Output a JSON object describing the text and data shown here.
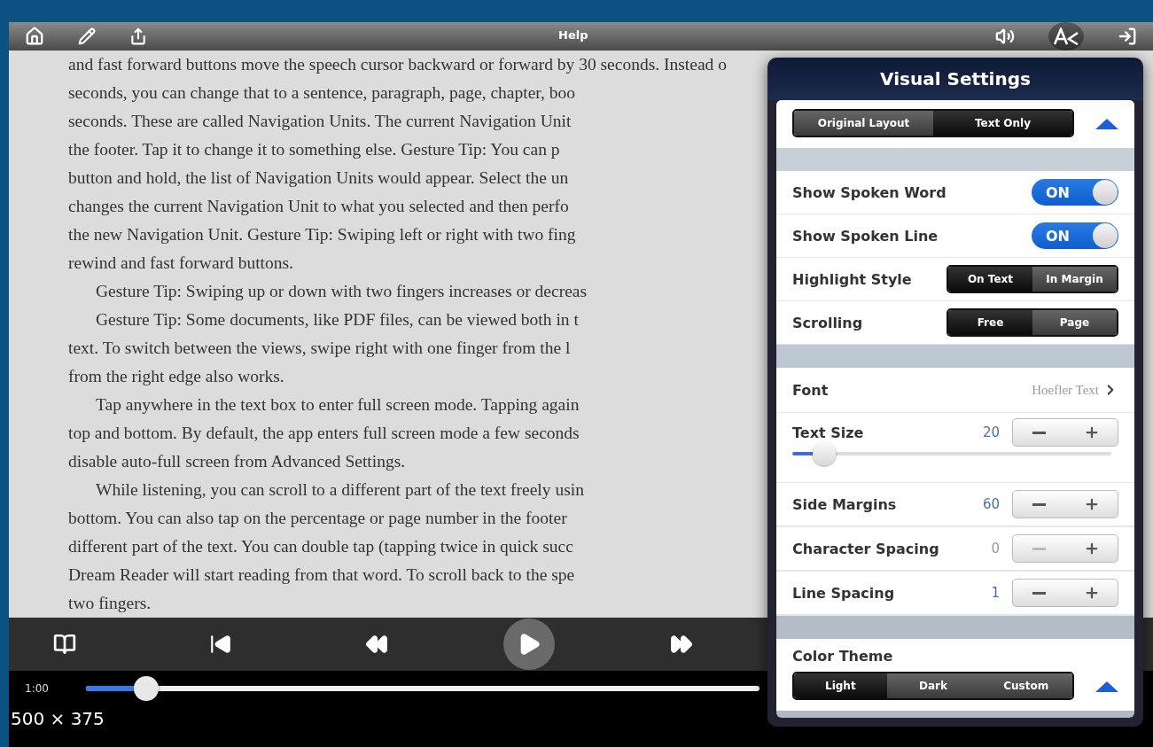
{
  "toolbar": {
    "title": "Help",
    "text_settings_selected": true
  },
  "reader": {
    "lines": [
      {
        "text": "and fast forward buttons move the speech cursor backward or forward by 30 seconds. Instead o",
        "indent": false
      },
      {
        "text": "seconds, you can change that to a sentence, paragraph, page, chapter, boo",
        "indent": false
      },
      {
        "text": "seconds. These are called Navigation Units. The current Navigation Unit",
        "indent": false
      },
      {
        "text": "the footer. Tap it to change it to something else. Gesture Tip: You can p",
        "indent": false
      },
      {
        "text": "button and hold, the list of Navigation Units would appear. Select the un",
        "indent": false
      },
      {
        "text": "changes the current Navigation Unit to what you selected and then perfo",
        "indent": false
      },
      {
        "text": "the new Navigation Unit. Gesture Tip: Swiping left or right with two fing",
        "indent": false
      },
      {
        "text": "rewind and fast forward buttons.",
        "indent": false
      },
      {
        "text": "Gesture Tip: Swiping up or down with two fingers increases or decreas",
        "indent": true
      },
      {
        "text": "Gesture Tip: Some documents, like PDF files, can be viewed both in t",
        "indent": true
      },
      {
        "text": "text. To switch between the views, swipe right with one finger from the l",
        "indent": false
      },
      {
        "text": "from the right edge also works.",
        "indent": false
      },
      {
        "text": "Tap anywhere in the text box to enter full screen mode. Tapping again",
        "indent": true
      },
      {
        "text": "top and bottom. By default, the app enters full screen mode a few seconds",
        "indent": false
      },
      {
        "text": "disable auto-full screen from Advanced Settings.",
        "indent": false
      },
      {
        "text": "While listening, you can scroll to a different part of the text freely usin",
        "indent": true
      },
      {
        "text": "bottom. You can also tap on the percentage or page number in the footer",
        "indent": false
      },
      {
        "text": "different part of the text. You can double tap (tapping twice in quick succ",
        "indent": false
      },
      {
        "text": "Dream Reader will start reading from that word. To scroll back to the spe",
        "indent": false
      },
      {
        "text": "two fingers.",
        "indent": false
      }
    ]
  },
  "player": {
    "time": "1:00",
    "progress": {
      "level": 0.09
    }
  },
  "image_size": "500 × 375",
  "visual_settings": {
    "title": "Visual Settings",
    "groups": [
      {
        "rows": [
          {
            "kind": "choice",
            "options": [
              {
                "label": "Original Layout",
                "selected": false
              },
              {
                "label": "Text Only",
                "selected": true
              }
            ],
            "expanded": true
          }
        ]
      },
      {
        "rows": [
          {
            "kind": "toggle",
            "label": "Show Spoken Word",
            "on": true,
            "switch_text": "ON"
          },
          {
            "kind": "toggle",
            "label": "Show Spoken Line",
            "on": true,
            "switch_text": "ON"
          },
          {
            "kind": "segmented",
            "label": "Highlight Style",
            "options": [
              {
                "label": "On Text",
                "selected": true
              },
              {
                "label": "In Margin",
                "selected": false
              }
            ]
          },
          {
            "kind": "segmented",
            "label": "Scrolling",
            "options": [
              {
                "label": "Free",
                "selected": true
              },
              {
                "label": "Page",
                "selected": false
              }
            ]
          }
        ]
      },
      {
        "rows": [
          {
            "kind": "link",
            "label": "Font",
            "value": "Hoefler Text"
          },
          {
            "kind": "stepper",
            "label": "Text Size",
            "value": "20",
            "at_minimum": false,
            "slider": {
              "level": 0.1
            }
          },
          {
            "kind": "stepper",
            "label": "Side Margins",
            "value": "60",
            "at_minimum": false
          },
          {
            "kind": "stepper",
            "label": "Character Spacing",
            "value": "0",
            "at_minimum": true
          },
          {
            "kind": "stepper",
            "label": "Line Spacing",
            "value": "1",
            "at_minimum": false
          }
        ]
      },
      {
        "rows": [
          {
            "kind": "choice",
            "label": "Color Theme",
            "options": [
              {
                "label": "Light",
                "selected": true
              },
              {
                "label": "Dark",
                "selected": false
              },
              {
                "label": "Custom",
                "selected": false
              }
            ],
            "expanded": true
          }
        ]
      }
    ]
  }
}
